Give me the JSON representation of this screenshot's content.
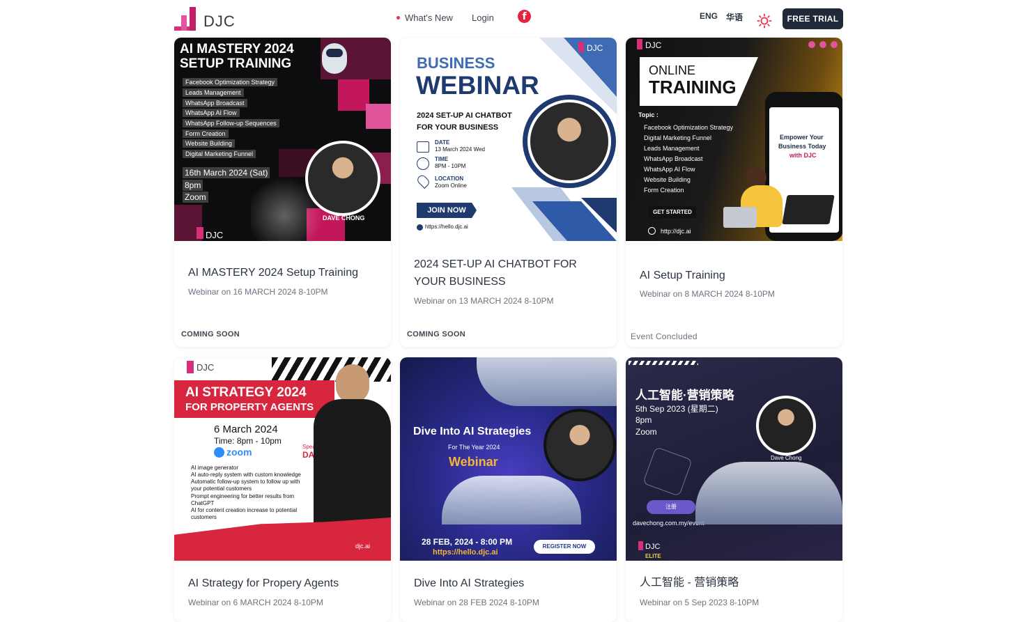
{
  "header": {
    "logo_text": "DJC",
    "nav_whats_new": "What's New",
    "nav_login": "Login",
    "facebook_glyph": "f",
    "lang_en": "ENG",
    "lang_zh": "华语",
    "theme_icon": "sun-icon",
    "cta": "FREE TRIAL"
  },
  "colors": {
    "brand_pink": "#d6307a",
    "dark": "#1f2937",
    "accent_red": "#e8374f",
    "navy": "#1e3a6e"
  },
  "cards": [
    {
      "title": "AI MASTERY 2024 Setup Training",
      "subtitle": "Webinar on 16 MARCH 2024 8-10PM",
      "status": "COMING SOON",
      "poster": {
        "headline1": "AI MASTERY 2024",
        "headline2": "SETUP TRAINING",
        "items": [
          "Facebook Optimization Strategy",
          "Leads Management",
          "WhatsApp Broadcast",
          "WhatsApp AI Flow",
          "WhatsApp Follow-up Sequences",
          "Form Creation",
          "Website Building",
          "Digital Marketing Funnel"
        ],
        "date": "16th March 2024 (Sat)",
        "time": "8pm",
        "venue": "Zoom",
        "speaker": "DAVE CHONG",
        "logo": "DJC"
      }
    },
    {
      "title": "2024 SET-UP AI CHATBOT FOR YOUR BUSINESS",
      "subtitle": "Webinar on 13 MARCH 2024 8-10PM",
      "status": "COMING SOON",
      "poster": {
        "kicker": "BUSINESS",
        "headline": "WEBINAR",
        "tagline1": "2024 SET-UP AI CHATBOT",
        "tagline2": "FOR YOUR BUSINESS",
        "date_label": "DATE",
        "date": "13 March 2024 Wed",
        "time_label": "TIME",
        "time": "8PM - 10PM",
        "loc_label": "LOCATION",
        "loc": "Zoom Online",
        "button": "JOIN NOW",
        "url": "https://hello.djc.ai",
        "logo": "DJC"
      }
    },
    {
      "title": "AI Setup Training",
      "subtitle": "Webinar on 8 MARCH 2024 8-10PM",
      "status": "Event Concluded",
      "poster": {
        "kicker": "ONLINE",
        "headline": "TRAINING",
        "topic_label": "Topic :",
        "topics": [
          "Facebook Optimization Strategy",
          "Digital Marketing Funnel",
          "Leads Management",
          "WhatsApp Broadcast",
          "WhatsApp AI Flow",
          "Website Building",
          "Form Creation"
        ],
        "phone_line1": "Empower Your",
        "phone_line2": "Business Today",
        "phone_line3": "with DJC",
        "button": "GET STARTED",
        "url": "http://djc.ai",
        "logo": "DJC"
      }
    },
    {
      "title": "AI Strategy for Propery Agents",
      "subtitle": "Webinar on 6 MARCH 2024 8-10PM",
      "status": "",
      "poster": {
        "headline1": "AI STRATEGY 2024",
        "headline2": "FOR  PROPERTY AGENTS",
        "date": "6 March 2024",
        "time": "Time:  8pm - 10pm",
        "zoom": "zoom",
        "speaker_label": "Speaker:",
        "speaker": "DAVE CHONG",
        "bullets": [
          "AI image generator",
          "AI auto-reply system with custom knowledge",
          "Automatic follow-up system to follow up with",
          "your potential customers",
          "Prompt engineering for better results from",
          "ChatGPT",
          "AI for content creation increase to potential",
          "customers"
        ],
        "site": "djc.ai",
        "logo": "DJC"
      }
    },
    {
      "title": "Dive Into AI Strategies",
      "subtitle": "Webinar on 28 FEB 2024 8-10PM",
      "status": "",
      "poster": {
        "headline": "Dive Into AI Strategies",
        "sub": "For The Year 2024",
        "kind": "Webinar",
        "datetime": "28 FEB, 2024 - 8:00 PM",
        "url": "https://hello.djc.ai",
        "button": "REGISTER NOW"
      }
    },
    {
      "title": "人工智能 - 营销策略",
      "subtitle": "Webinar on 5 Sep 2023 8-10PM",
      "status": "",
      "poster": {
        "headline": "人工智能·营销策略",
        "date": "5th Sep 2023 (星期二)",
        "time": "8pm",
        "venue": "Zoom",
        "speaker": "Dave Chong",
        "button": "注册",
        "url": "davechong.com.my/event",
        "logo": "DJC",
        "partner": "ELITE"
      }
    }
  ]
}
